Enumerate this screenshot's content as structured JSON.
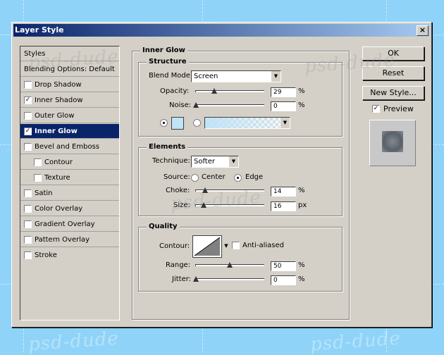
{
  "watermark": "psd-dude",
  "dialog": {
    "title": "Layer Style",
    "close_label": "×"
  },
  "sidebar": {
    "styles_label": "Styles",
    "blending_label": "Blending Options: Default",
    "items": [
      {
        "label": "Drop Shadow",
        "checked": false
      },
      {
        "label": "Inner Shadow",
        "checked": true
      },
      {
        "label": "Outer Glow",
        "checked": false
      },
      {
        "label": "Inner Glow",
        "checked": true,
        "selected": true
      },
      {
        "label": "Bevel and Emboss",
        "checked": false
      },
      {
        "label": "Contour",
        "checked": false,
        "sub": true
      },
      {
        "label": "Texture",
        "checked": false,
        "sub": true
      },
      {
        "label": "Satin",
        "checked": false
      },
      {
        "label": "Color Overlay",
        "checked": false
      },
      {
        "label": "Gradient Overlay",
        "checked": false
      },
      {
        "label": "Pattern Overlay",
        "checked": false
      },
      {
        "label": "Stroke",
        "checked": false
      }
    ]
  },
  "panel": {
    "title": "Inner Glow",
    "structure": {
      "title": "Structure",
      "blend_mode_label": "Blend Mode:",
      "blend_mode": "Screen",
      "opacity_label": "Opacity:",
      "opacity": "29",
      "noise_label": "Noise:",
      "noise": "0",
      "unit_percent": "%",
      "glow_color": "#bfe3f7"
    },
    "elements": {
      "title": "Elements",
      "technique_label": "Technique:",
      "technique": "Softer",
      "source_label": "Source:",
      "source_center": "Center",
      "source_edge": "Edge",
      "choke_label": "Choke:",
      "choke": "14",
      "size_label": "Size:",
      "size": "16",
      "unit_px": "px"
    },
    "quality": {
      "title": "Quality",
      "contour_label": "Contour:",
      "antialiased_label": "Anti-aliased",
      "range_label": "Range:",
      "range": "50",
      "jitter_label": "Jitter:",
      "jitter": "0"
    }
  },
  "buttons": {
    "ok": "OK",
    "reset": "Reset",
    "new_style": "New Style...",
    "preview": "Preview",
    "preview_checked": true
  }
}
